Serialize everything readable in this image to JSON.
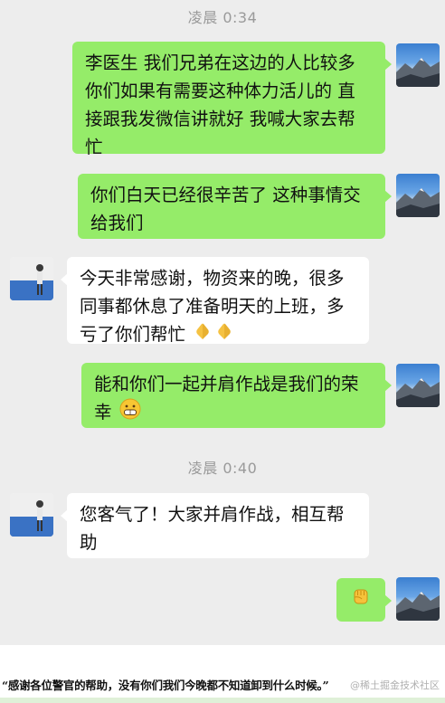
{
  "timestamps": [
    "凌晨 0:34",
    "凌晨 0:40"
  ],
  "messages": [
    {
      "side": "me",
      "text": "李医生 我们兄弟在这边的人比较多 你们如果有需要这种体力活儿的 直接跟我发微信讲就好 我喊大家去帮忙"
    },
    {
      "side": "me",
      "text": "你们白天已经很辛苦了 这种事情交给我们"
    },
    {
      "side": "other",
      "text": "今天非常感谢，物资来的晚，很多同事都休息了准备明天的上班，多亏了你们帮忙",
      "emoji": [
        "folded-hands-icon",
        "folded-hands-icon"
      ]
    },
    {
      "side": "me",
      "text": "能和你们一起并肩作战是我们的荣幸",
      "emoji": [
        "grinning-face-icon"
      ]
    },
    {
      "side": "other",
      "text": "您客气了！大家并肩作战，相互帮助"
    },
    {
      "side": "me",
      "text": "",
      "emoji": [
        "fist-icon"
      ]
    }
  ],
  "caption": "“感谢各位警官的帮助，没有你们我们今晚都不知道卸到什么时候。”",
  "watermark": "@稀土掘金技术社区",
  "colors": {
    "me_bubble": "#95ec69",
    "other_bubble": "#ffffff",
    "background": "#ededed"
  }
}
